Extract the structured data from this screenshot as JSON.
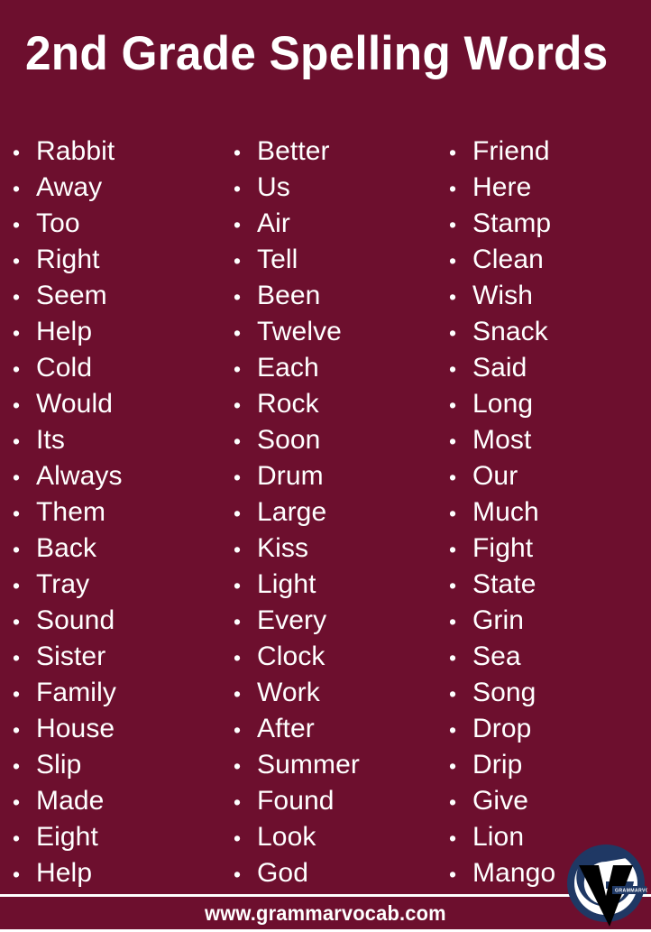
{
  "header": {
    "title": "2nd Grade Spelling Words"
  },
  "theme": {
    "background_color": "#6d0f2e",
    "text_color": "#ffffff",
    "logo_ring_color": "#1f3864",
    "logo_v_color": "#000000"
  },
  "bullet_glyph": "•",
  "columns": [
    {
      "name": "column-1",
      "words": [
        "Rabbit",
        "Away",
        "Too",
        "Right",
        "Seem",
        "Help",
        "Cold",
        "Would",
        "Its",
        "Always",
        "Them",
        "Back",
        "Tray",
        "Sound",
        "Sister",
        "Family",
        "House",
        "Slip",
        "Made",
        "Eight",
        "Help"
      ]
    },
    {
      "name": "column-2",
      "words": [
        "Better",
        "Us",
        "Air",
        "Tell",
        "Been",
        "Twelve",
        "Each",
        "Rock",
        "Soon",
        "Drum",
        "Large",
        "Kiss",
        "Light",
        "Every",
        "Clock",
        "Work",
        "After",
        "Summer",
        "Found",
        "Look",
        "God"
      ]
    },
    {
      "name": "column-3",
      "words": [
        "Friend",
        "Here",
        "Stamp",
        "Clean",
        "Wish",
        "Snack",
        "Said",
        "Long",
        "Most",
        "Our",
        "Much",
        "Fight",
        "State",
        "Grin",
        "Sea",
        "Song",
        "Drop",
        "Drip",
        "Give",
        "Lion",
        "Mango"
      ]
    }
  ],
  "footer": {
    "url": "www.grammarvocab.com"
  },
  "logo": {
    "wordmark": "GRAMMARVOCAB"
  }
}
